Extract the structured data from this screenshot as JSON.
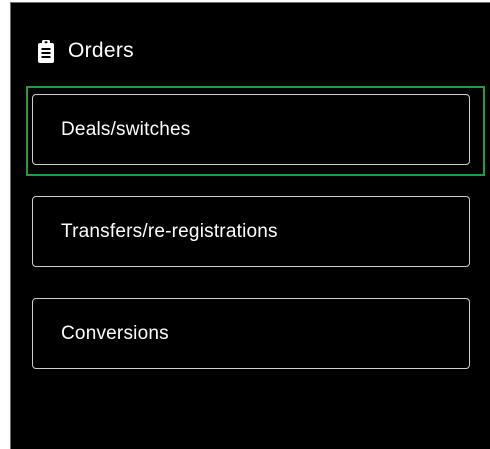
{
  "header": {
    "icon": "clipboard-icon",
    "title": "Orders"
  },
  "menu": {
    "items": [
      {
        "label": "Deals/switches",
        "focused": true
      },
      {
        "label": "Transfers/re-registrations",
        "focused": false
      },
      {
        "label": "Conversions",
        "focused": false
      }
    ]
  },
  "colors": {
    "background": "#000000",
    "text": "#ffffff",
    "item_border": "#cfcfcf",
    "focus_ring": "#1e9e3e"
  }
}
